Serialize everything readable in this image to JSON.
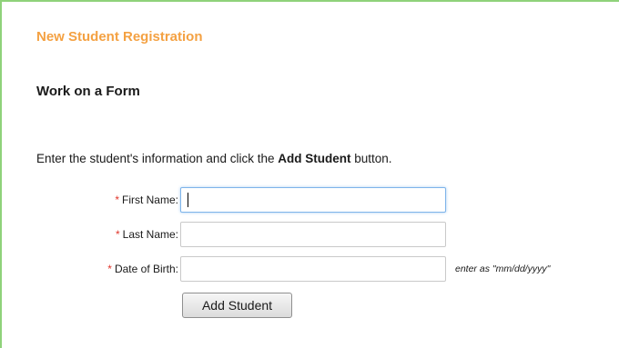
{
  "panel": {
    "section_title": "New Student Registration",
    "heading": "Work on a Form",
    "instructions": {
      "before": "Enter the student's information and click the ",
      "bold": "Add Student",
      "after": " button."
    }
  },
  "form": {
    "required_marker": "*",
    "first_name": {
      "label": "First Name:",
      "value": ""
    },
    "last_name": {
      "label": "Last Name:",
      "value": ""
    },
    "date_of_birth": {
      "label": "Date of Birth:",
      "value": "",
      "hint": "enter as \"mm/dd/yyyy\""
    },
    "submit_label": "Add Student"
  },
  "colors": {
    "frame_border": "#8fd27a",
    "section_title": "#f4a142",
    "required_marker": "#e0362b",
    "focus_ring": "#7eb4ea"
  }
}
